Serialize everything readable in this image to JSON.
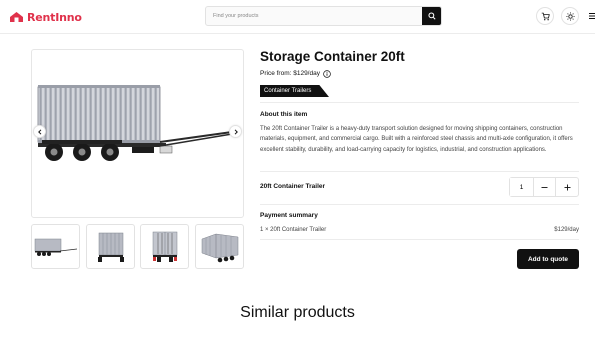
{
  "header": {
    "logo_text": "RentInno",
    "brand_color": "#e0324b",
    "search_placeholder": "Find your products",
    "icons": [
      "search-icon",
      "cart-icon",
      "sun-icon",
      "menu-icon"
    ]
  },
  "gallery": {
    "main_image": "container-trailer-side-view",
    "thumbnails": [
      "container-trailer-side-thumb",
      "container-trailer-front-thumb",
      "container-trailer-rear-thumb",
      "container-trailer-angle-thumb"
    ],
    "arrow_icons": [
      "chevron-left-icon",
      "chevron-right-icon"
    ]
  },
  "product": {
    "title": "Storage Container 20ft",
    "price": "Price from: $129/day",
    "category": "Container Trailers",
    "about_title": "About this item",
    "about_text": "The 20ft Container Trailer is a heavy-duty transport solution designed for moving shipping containers, construction materials, equipment, and commercial cargo. Built with a reinforced steel chassis and multi-axle configuration, it offers excellent stability, durability, and load-carrying capacity for logistics, industrial, and construction applications.",
    "selection_label": "20ft Container Trailer",
    "quantity": "1"
  },
  "payment": {
    "title": "Payment summary",
    "line_item": "1 × 20ft Container Trailer",
    "line_total": "$129/day",
    "cta": "Add to quote"
  },
  "similar": {
    "title": "Similar products"
  }
}
